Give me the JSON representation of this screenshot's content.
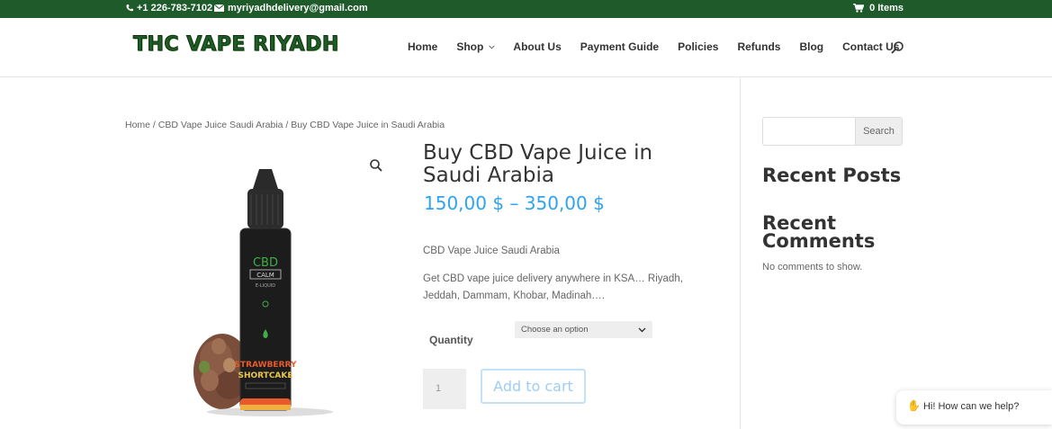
{
  "topbar": {
    "phone": "+1 226-783-7102",
    "email": "myriyadhdelivery@gmail.com",
    "cart": "0 Items"
  },
  "header": {
    "logo": "THC VAPE RIYADH",
    "nav": [
      "Home",
      "Shop",
      "About Us",
      "Payment Guide",
      "Policies",
      "Refunds",
      "Blog",
      "Contact Us"
    ]
  },
  "breadcrumb": {
    "home": "Home",
    "sep1": " / ",
    "category": "CBD Vape Juice Saudi Arabia",
    "sep2": " / ",
    "current": "Buy CBD Vape Juice in Saudi Arabia"
  },
  "product": {
    "title": "Buy CBD Vape Juice in Saudi Arabia",
    "price": "150,00 $ – 350,00 $",
    "short_desc": "CBD Vape Juice Saudi Arabia",
    "desc": "Get CBD vape juice delivery anywhere in KSA… Riyadh, Jeddah, Dammam, Khobar, Madinah….",
    "option_label": "Quantity",
    "option_placeholder": "Choose an option",
    "qty_value": "1",
    "add_to_cart": "Add to cart",
    "bottle": {
      "brand": "CBD",
      "line": "CALM",
      "type": "E-LIQUID",
      "flavor_1": "STRAWBERRY",
      "flavor_2": "SHORTCAKE"
    }
  },
  "sidebar": {
    "search_button": "Search",
    "recent_posts": "Recent Posts",
    "recent_comments": "Recent Comments",
    "no_comments": "No comments to show."
  },
  "chat": {
    "text": "Hi! How can we help?"
  },
  "colors": {
    "topbar": "#1e5a2a",
    "accent": "#2ea3f2",
    "logo": "#1f5d26"
  }
}
